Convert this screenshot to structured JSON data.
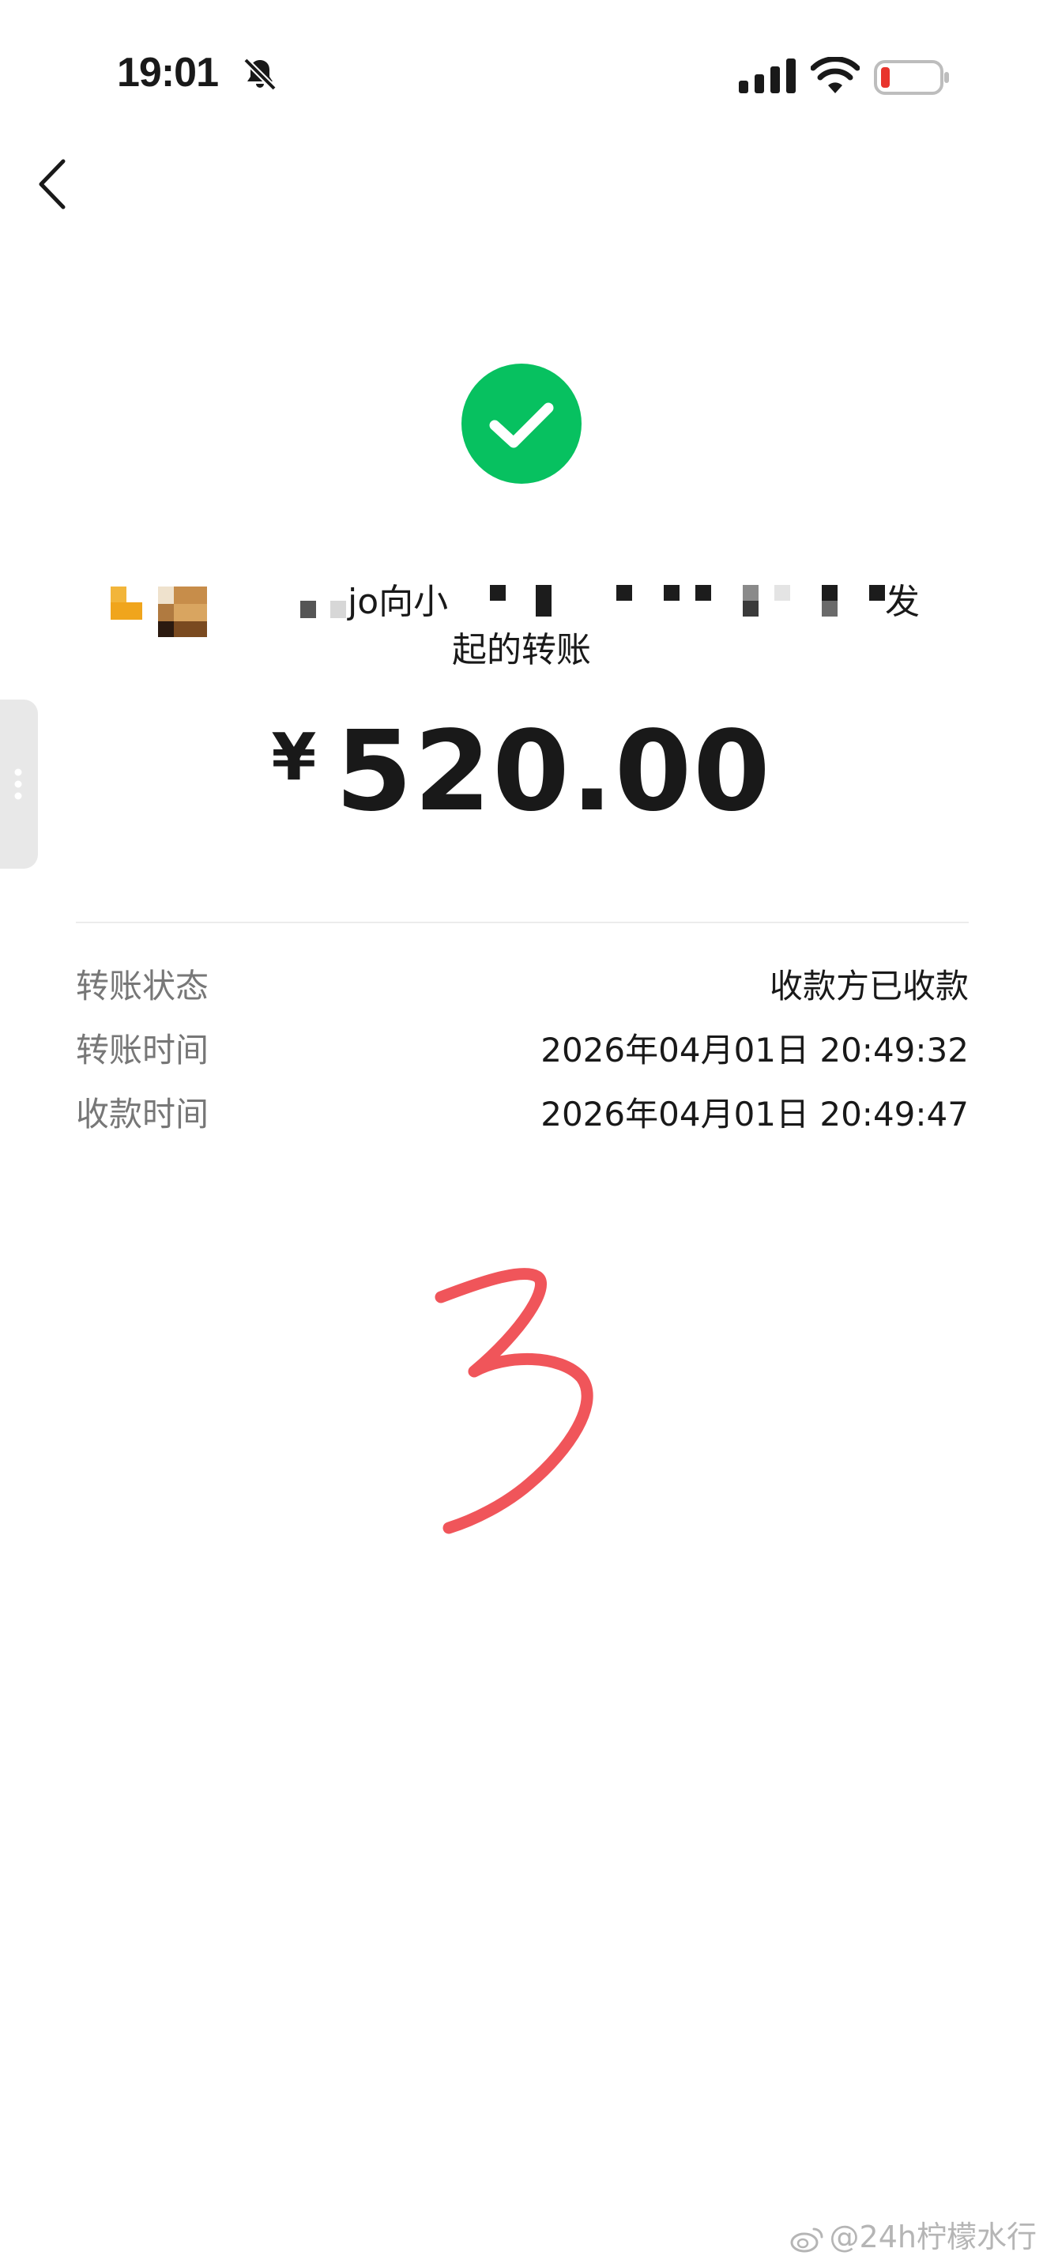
{
  "status_bar": {
    "time": "19:01",
    "battery_level": 0.12,
    "battery_color": "#e8342d"
  },
  "nav": {
    "back_icon": "chevron-left-icon"
  },
  "transfer": {
    "status_icon": "check-circle-icon",
    "status_icon_color": "#07c160",
    "initiator_prefix": "jo向小",
    "initiator_suffix": "发",
    "initiator_line2": "起的转账",
    "currency_symbol": "¥",
    "amount": "520.00"
  },
  "details": [
    {
      "label": "转账状态",
      "value": "收款方已收款"
    },
    {
      "label": "转账时间",
      "value": "2026年04月01日 20:49:32"
    },
    {
      "label": "收款时间",
      "value": "2026年04月01日 20:49:47"
    }
  ],
  "annotation": {
    "handwritten_number": "3",
    "color": "#f0555a"
  },
  "watermark": {
    "text": "@24h柠檬水行"
  }
}
